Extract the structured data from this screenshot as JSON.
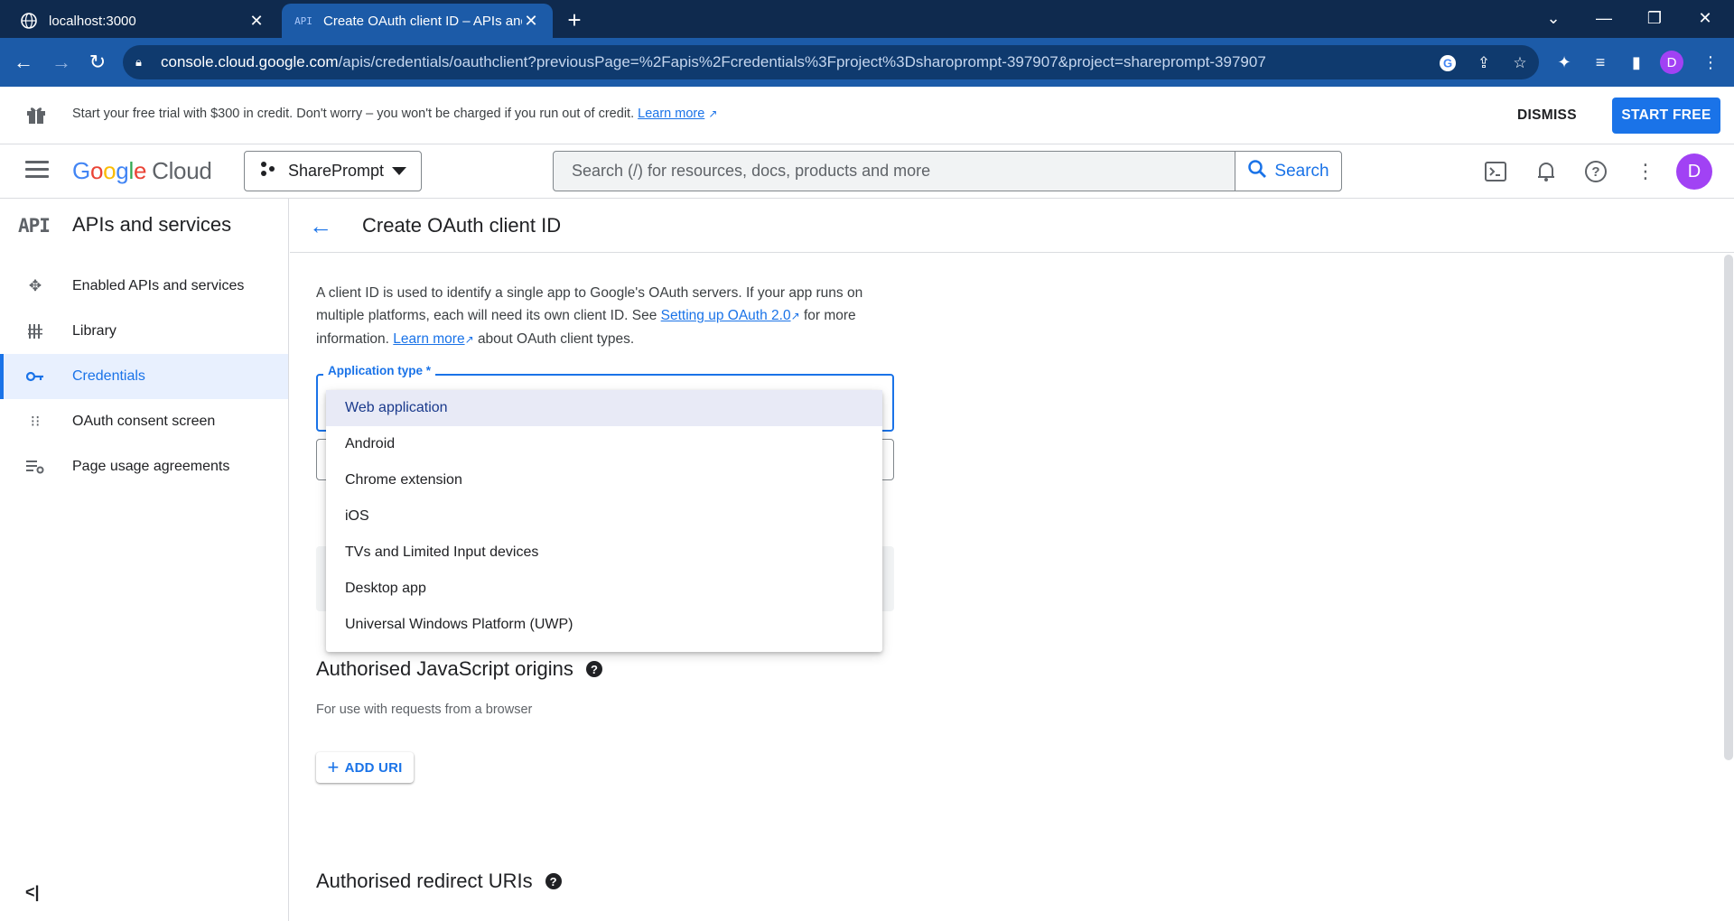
{
  "browser": {
    "tabs": [
      {
        "title": "localhost:3000",
        "active": false,
        "icon": "globe-icon"
      },
      {
        "title": "Create OAuth client ID – APIs and",
        "active": true,
        "icon": "api-icon",
        "favicon_text": "API"
      }
    ],
    "url_host": "console.cloud.google.com",
    "url_path": "/apis/credentials/oauthclient?previousPage=%2Fapis%2Fcredentials%3Fproject%3Dsharoprompt-397907&project=shareprompt-397907",
    "profile_initial": "D"
  },
  "banner": {
    "text": "Start your free trial with $300 in credit. Don't worry – you won't be charged if you run out of credit.",
    "link": "Learn more",
    "dismiss": "DISMISS",
    "start": "START FREE"
  },
  "header": {
    "logo_google": "Google",
    "logo_cloud": "Cloud",
    "project": "SharePrompt",
    "search_placeholder": "Search (/) for resources, docs, products and more",
    "search_button": "Search",
    "avatar": "D"
  },
  "sidebar": {
    "mark": "API",
    "title": "APIs and services",
    "items": [
      {
        "label": "Enabled APIs and services",
        "icon": "hub-icon"
      },
      {
        "label": "Library",
        "icon": "library-icon"
      },
      {
        "label": "Credentials",
        "icon": "key-icon",
        "active": true
      },
      {
        "label": "OAuth consent screen",
        "icon": "consent-icon"
      },
      {
        "label": "Page usage agreements",
        "icon": "settings-list-icon"
      }
    ],
    "collapse": "<|"
  },
  "main": {
    "title": "Create OAuth client ID",
    "intro_1": "A client ID is used to identify a single app to Google's OAuth servers. If your app runs on multiple platforms, each will need its own client ID. See",
    "intro_link_1": "Setting up OAuth 2.0",
    "intro_2": "for more information.",
    "intro_link_2": "Learn more",
    "intro_3": "about OAuth client types.",
    "app_type_label": "Application type *",
    "app_type_options": [
      "Web application",
      "Android",
      "Chrome extension",
      "iOS",
      "TVs and Limited Input devices",
      "Desktop app",
      "Universal Windows Platform (UWP)"
    ],
    "selected_option": "Web application",
    "js_origins_title": "Authorised JavaScript origins",
    "js_origins_sub": "For use with requests from a browser",
    "add_uri": "ADD URI",
    "redirect_title": "Authorised redirect URIs"
  },
  "colors": {
    "accent": "#1a73e8",
    "chrome_dark": "#0f2a4e",
    "chrome_mid": "#1c5ba8",
    "avatar": "#a142f4"
  }
}
